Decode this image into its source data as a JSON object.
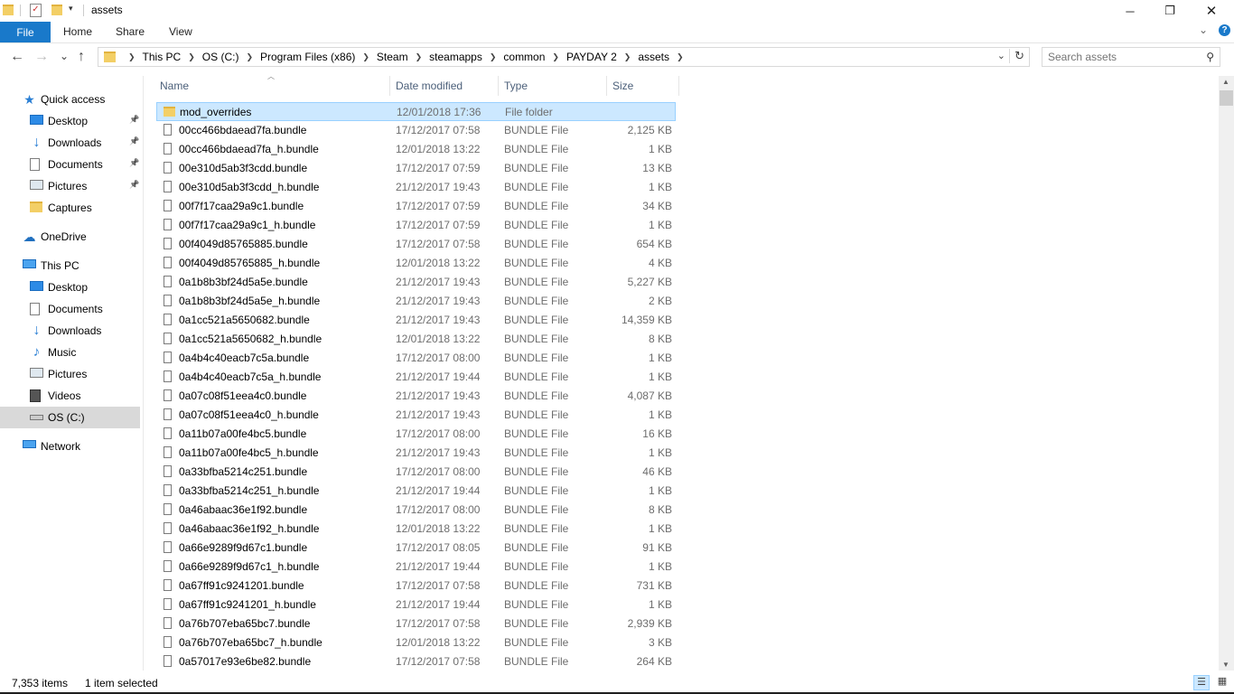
{
  "window": {
    "title": "assets",
    "minimize": "─",
    "restore": "❐",
    "close": "✕"
  },
  "ribbon": {
    "tabs": [
      "File",
      "Home",
      "Share",
      "View"
    ],
    "expand": "⌄",
    "help": "?"
  },
  "navigation": {
    "back": "←",
    "forward": "→",
    "recent": "⌄",
    "up": "↑",
    "breadcrumbs": [
      "This PC",
      "OS (C:)",
      "Program Files (x86)",
      "Steam",
      "steamapps",
      "common",
      "PAYDAY 2",
      "assets"
    ],
    "search_placeholder": "Search assets"
  },
  "sidebar": {
    "items": [
      {
        "label": "Quick access",
        "icon": "star-icon",
        "pinned": false
      },
      {
        "label": "Desktop",
        "icon": "desktop-icon",
        "pinned": true
      },
      {
        "label": "Downloads",
        "icon": "download-icon",
        "pinned": true
      },
      {
        "label": "Documents",
        "icon": "documents-icon",
        "pinned": true
      },
      {
        "label": "Pictures",
        "icon": "pictures-icon",
        "pinned": true
      },
      {
        "label": "Captures",
        "icon": "folder-icon",
        "pinned": false
      },
      {
        "label": "OneDrive",
        "icon": "onedrive-icon",
        "pinned": false
      },
      {
        "label": "This PC",
        "icon": "computer-icon",
        "pinned": false
      },
      {
        "label": "Desktop",
        "icon": "desktop-icon",
        "pinned": false
      },
      {
        "label": "Documents",
        "icon": "documents-icon",
        "pinned": false
      },
      {
        "label": "Downloads",
        "icon": "download-icon",
        "pinned": false
      },
      {
        "label": "Music",
        "icon": "music-icon",
        "pinned": false
      },
      {
        "label": "Pictures",
        "icon": "pictures-icon",
        "pinned": false
      },
      {
        "label": "Videos",
        "icon": "videos-icon",
        "pinned": false
      },
      {
        "label": "OS (C:)",
        "icon": "drive-icon",
        "pinned": false,
        "selected": true
      },
      {
        "label": "Network",
        "icon": "network-icon",
        "pinned": false
      }
    ]
  },
  "columns": {
    "name": "Name",
    "date": "Date modified",
    "type": "Type",
    "size": "Size"
  },
  "files": [
    {
      "name": "mod_overrides",
      "date": "12/01/2018 17:36",
      "type": "File folder",
      "size": "",
      "folder": true,
      "selected": true
    },
    {
      "name": "00cc466bdaead7fa.bundle",
      "date": "17/12/2017 07:58",
      "type": "BUNDLE File",
      "size": "2,125 KB"
    },
    {
      "name": "00cc466bdaead7fa_h.bundle",
      "date": "12/01/2018 13:22",
      "type": "BUNDLE File",
      "size": "1 KB"
    },
    {
      "name": "00e310d5ab3f3cdd.bundle",
      "date": "17/12/2017 07:59",
      "type": "BUNDLE File",
      "size": "13 KB"
    },
    {
      "name": "00e310d5ab3f3cdd_h.bundle",
      "date": "21/12/2017 19:43",
      "type": "BUNDLE File",
      "size": "1 KB"
    },
    {
      "name": "00f7f17caa29a9c1.bundle",
      "date": "17/12/2017 07:59",
      "type": "BUNDLE File",
      "size": "34 KB"
    },
    {
      "name": "00f7f17caa29a9c1_h.bundle",
      "date": "17/12/2017 07:59",
      "type": "BUNDLE File",
      "size": "1 KB"
    },
    {
      "name": "00f4049d85765885.bundle",
      "date": "17/12/2017 07:58",
      "type": "BUNDLE File",
      "size": "654 KB"
    },
    {
      "name": "00f4049d85765885_h.bundle",
      "date": "12/01/2018 13:22",
      "type": "BUNDLE File",
      "size": "4 KB"
    },
    {
      "name": "0a1b8b3bf24d5a5e.bundle",
      "date": "21/12/2017 19:43",
      "type": "BUNDLE File",
      "size": "5,227 KB"
    },
    {
      "name": "0a1b8b3bf24d5a5e_h.bundle",
      "date": "21/12/2017 19:43",
      "type": "BUNDLE File",
      "size": "2 KB"
    },
    {
      "name": "0a1cc521a5650682.bundle",
      "date": "21/12/2017 19:43",
      "type": "BUNDLE File",
      "size": "14,359 KB"
    },
    {
      "name": "0a1cc521a5650682_h.bundle",
      "date": "12/01/2018 13:22",
      "type": "BUNDLE File",
      "size": "8 KB"
    },
    {
      "name": "0a4b4c40eacb7c5a.bundle",
      "date": "17/12/2017 08:00",
      "type": "BUNDLE File",
      "size": "1 KB"
    },
    {
      "name": "0a4b4c40eacb7c5a_h.bundle",
      "date": "21/12/2017 19:44",
      "type": "BUNDLE File",
      "size": "1 KB"
    },
    {
      "name": "0a07c08f51eea4c0.bundle",
      "date": "21/12/2017 19:43",
      "type": "BUNDLE File",
      "size": "4,087 KB"
    },
    {
      "name": "0a07c08f51eea4c0_h.bundle",
      "date": "21/12/2017 19:43",
      "type": "BUNDLE File",
      "size": "1 KB"
    },
    {
      "name": "0a11b07a00fe4bc5.bundle",
      "date": "17/12/2017 08:00",
      "type": "BUNDLE File",
      "size": "16 KB"
    },
    {
      "name": "0a11b07a00fe4bc5_h.bundle",
      "date": "21/12/2017 19:43",
      "type": "BUNDLE File",
      "size": "1 KB"
    },
    {
      "name": "0a33bfba5214c251.bundle",
      "date": "17/12/2017 08:00",
      "type": "BUNDLE File",
      "size": "46 KB"
    },
    {
      "name": "0a33bfba5214c251_h.bundle",
      "date": "21/12/2017 19:44",
      "type": "BUNDLE File",
      "size": "1 KB"
    },
    {
      "name": "0a46abaac36e1f92.bundle",
      "date": "17/12/2017 08:00",
      "type": "BUNDLE File",
      "size": "8 KB"
    },
    {
      "name": "0a46abaac36e1f92_h.bundle",
      "date": "12/01/2018 13:22",
      "type": "BUNDLE File",
      "size": "1 KB"
    },
    {
      "name": "0a66e9289f9d67c1.bundle",
      "date": "17/12/2017 08:05",
      "type": "BUNDLE File",
      "size": "91 KB"
    },
    {
      "name": "0a66e9289f9d67c1_h.bundle",
      "date": "21/12/2017 19:44",
      "type": "BUNDLE File",
      "size": "1 KB"
    },
    {
      "name": "0a67ff91c9241201.bundle",
      "date": "17/12/2017 07:58",
      "type": "BUNDLE File",
      "size": "731 KB"
    },
    {
      "name": "0a67ff91c9241201_h.bundle",
      "date": "21/12/2017 19:44",
      "type": "BUNDLE File",
      "size": "1 KB"
    },
    {
      "name": "0a76b707eba65bc7.bundle",
      "date": "17/12/2017 07:58",
      "type": "BUNDLE File",
      "size": "2,939 KB"
    },
    {
      "name": "0a76b707eba65bc7_h.bundle",
      "date": "12/01/2018 13:22",
      "type": "BUNDLE File",
      "size": "3 KB"
    },
    {
      "name": "0a57017e93e6be82.bundle",
      "date": "17/12/2017 07:58",
      "type": "BUNDLE File",
      "size": "264 KB"
    }
  ],
  "status": {
    "item_count": "7,353 items",
    "selection": "1 item selected"
  },
  "colors": {
    "accent": "#1979ca",
    "selection_bg": "#cce8ff",
    "selection_border": "#99d1ff",
    "folder": "#f3cf66",
    "header_text": "#4c607a"
  }
}
